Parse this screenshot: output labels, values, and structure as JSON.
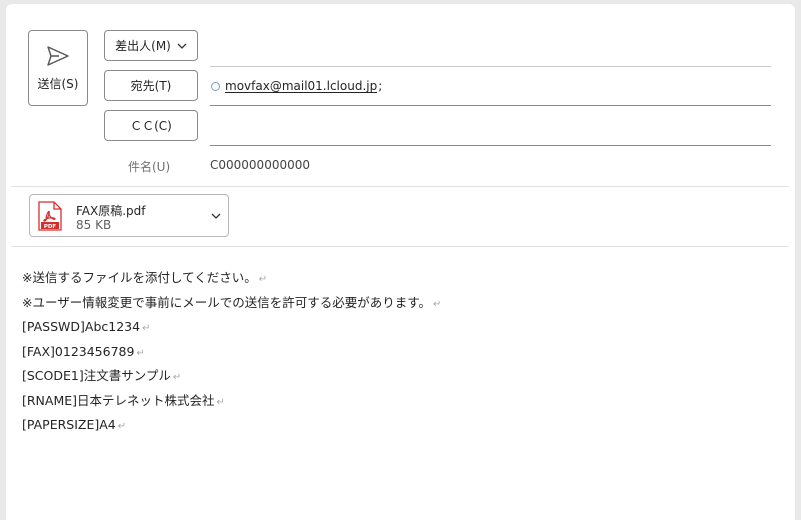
{
  "compose": {
    "send_label": "送信(S)",
    "from_label": "差出人(M)",
    "to_label": "宛先(T)",
    "cc_label": "ＣＣ(C)",
    "subject_label": "件名(U)",
    "subject_value": "C000000000000",
    "to_recipients": [
      {
        "address": "movfax@mail01.lcloud.jp",
        "separator": ";"
      }
    ],
    "cc_value": ""
  },
  "attachment": {
    "file_name": "FAX原稿.pdf",
    "file_size": "85 KB",
    "icon": "pdf-file-icon"
  },
  "body": {
    "return_mark": "↵",
    "lines": [
      "※送信するファイルを添付してください。",
      "※ユーザー情報変更で事前にメールでの送信を許可する必要があります。",
      "[PASSWD]Abc1234",
      "[FAX]0123456789",
      "[SCODE1]注文書サンプル",
      "[RNAME]日本テレネット株式会社",
      "[PAPERSIZE]A4"
    ]
  },
  "colors": {
    "background": "#e9e9e9",
    "panel": "#ffffff",
    "button_border": "#8a8a8a",
    "pdf_red": "#d32f2f",
    "presence_ring": "#7a9cc4"
  }
}
